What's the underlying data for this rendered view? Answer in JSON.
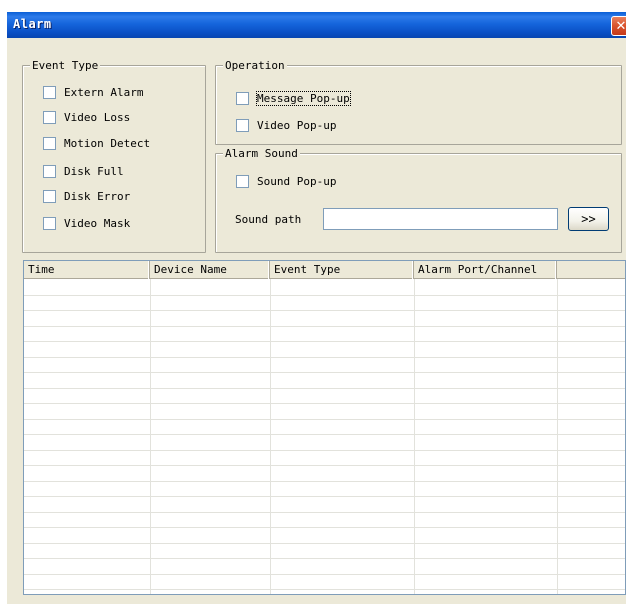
{
  "window": {
    "title": "Alarm",
    "close_glyph": "✕"
  },
  "event_type": {
    "legend": "Event Type",
    "items": [
      {
        "label": "Extern Alarm",
        "checked": false
      },
      {
        "label": "Video Loss",
        "checked": false
      },
      {
        "label": "Motion Detect",
        "checked": false
      },
      {
        "label": "Disk Full",
        "checked": false
      },
      {
        "label": "Disk Error",
        "checked": false
      },
      {
        "label": "Video Mask",
        "checked": false
      }
    ]
  },
  "operation": {
    "legend": "Operation",
    "items": [
      {
        "label": "Message Pop-up",
        "checked": false
      },
      {
        "label": "Video Pop-up",
        "checked": false
      }
    ]
  },
  "alarm_sound": {
    "legend": "Alarm Sound",
    "sound_popup": {
      "label": "Sound Pop-up",
      "checked": false
    },
    "sound_path_label": "Sound path",
    "sound_path_value": "",
    "browse_label": ">>"
  },
  "table": {
    "columns": [
      "Time",
      "Device Name",
      "Event Type",
      "Alarm Port/Channel",
      ""
    ],
    "rows": []
  }
}
